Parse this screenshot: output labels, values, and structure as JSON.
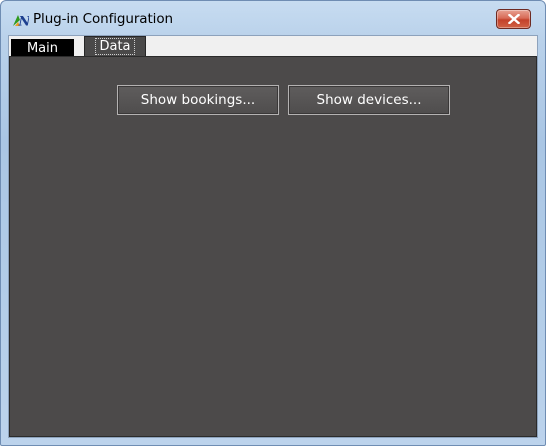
{
  "window": {
    "title": "Plug-in Configuration",
    "app_icon": "app-logo-icon",
    "close_icon": "close-icon"
  },
  "tabs": [
    {
      "label": "Main",
      "selected": false
    },
    {
      "label": "Data",
      "selected": true
    }
  ],
  "panel": {
    "buttons": {
      "show_bookings": "Show bookings...",
      "show_devices": "Show devices..."
    }
  },
  "colors": {
    "panel_bg": "#4c4a4a",
    "tab_main_bg": "#000000",
    "tab_data_bg": "#4a4949",
    "close_button": "#c3422b"
  }
}
